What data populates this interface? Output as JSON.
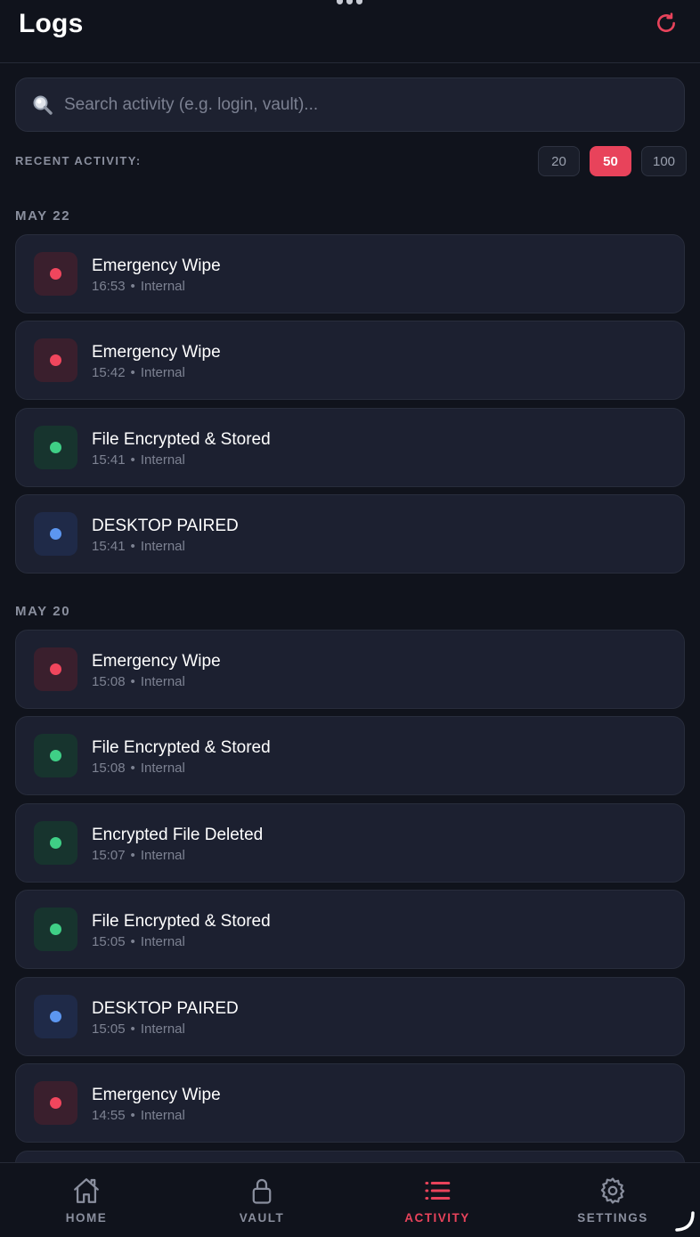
{
  "header": {
    "title": "Logs"
  },
  "search": {
    "placeholder": "Search activity (e.g. login, vault)..."
  },
  "recent": {
    "label": "RECENT ACTIVITY:",
    "limits": [
      {
        "label": "20",
        "active": false
      },
      {
        "label": "50",
        "active": true
      },
      {
        "label": "100",
        "active": false
      }
    ]
  },
  "sections": [
    {
      "date": "MAY 22",
      "entries": [
        {
          "title": "Emergency Wipe",
          "time": "16:53",
          "source": "Internal",
          "status": "red"
        },
        {
          "title": "Emergency Wipe",
          "time": "15:42",
          "source": "Internal",
          "status": "red"
        },
        {
          "title": "File Encrypted & Stored",
          "time": "15:41",
          "source": "Internal",
          "status": "green"
        },
        {
          "title": "DESKTOP PAIRED",
          "time": "15:41",
          "source": "Internal",
          "status": "blue"
        }
      ]
    },
    {
      "date": "MAY 20",
      "entries": [
        {
          "title": "Emergency Wipe",
          "time": "15:08",
          "source": "Internal",
          "status": "red"
        },
        {
          "title": "File Encrypted & Stored",
          "time": "15:08",
          "source": "Internal",
          "status": "green"
        },
        {
          "title": "Encrypted File Deleted",
          "time": "15:07",
          "source": "Internal",
          "status": "green"
        },
        {
          "title": "File Encrypted & Stored",
          "time": "15:05",
          "source": "Internal",
          "status": "green"
        },
        {
          "title": "DESKTOP PAIRED",
          "time": "15:05",
          "source": "Internal",
          "status": "blue"
        },
        {
          "title": "Emergency Wipe",
          "time": "14:55",
          "source": "Internal",
          "status": "red"
        }
      ]
    }
  ],
  "nav": [
    {
      "label": "HOME",
      "icon": "home-icon",
      "active": false
    },
    {
      "label": "VAULT",
      "icon": "lock-icon",
      "active": false
    },
    {
      "label": "ACTIVITY",
      "icon": "list-icon",
      "active": true
    },
    {
      "label": "SETTINGS",
      "icon": "gear-icon",
      "active": false
    }
  ],
  "colors": {
    "accent": "#e8435b",
    "red": "#f0465d",
    "green": "#3fcf86",
    "blue": "#5c96f0",
    "background": "#10131c",
    "card": "#1c2030"
  }
}
